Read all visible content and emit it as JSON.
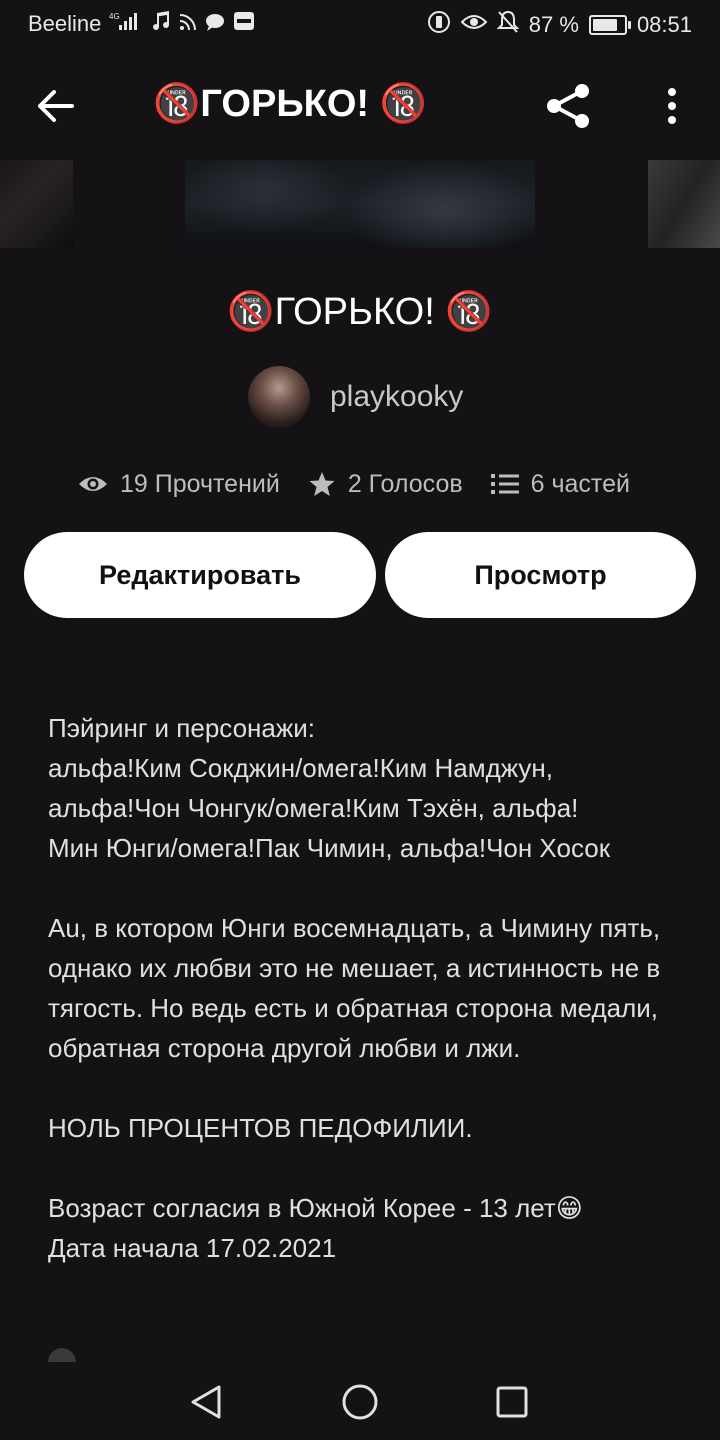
{
  "status_bar": {
    "carrier": "Beeline",
    "network": "4G",
    "battery_percent": "87 %",
    "battery_level": 0.87,
    "time": "08:51"
  },
  "app_bar": {
    "title": "🔞ГОРЬКО! 🔞"
  },
  "story": {
    "title": "🔞ГОРЬКО! 🔞",
    "author": "playkooky",
    "reads": "19 Прочтений",
    "votes": "2 Голосов",
    "parts": "6 частей"
  },
  "buttons": {
    "edit": "Редактировать",
    "view": "Просмотр"
  },
  "description": {
    "pairing_label": "Пэйринг и персонажи:",
    "pairing_1": "альфа!Ким Сокджин/омега!Ким Намджун,",
    "pairing_2": "альфа!Чон Чонгук/омега!Ким Тэхён, альфа!",
    "pairing_3": "Мин Юнги/омега!Пак Чимин, альфа!Чон Хосок",
    "summary": "Au, в котором Юнги восемнадцать, а Чимину пять, однако их любви это не мешает, а истинность не в тягость. Но ведь есть и обратная сторона медали, обратная сторона другой любви и лжи.",
    "notice": "НОЛЬ ПРОЦЕНТОВ ПЕДОФИЛИИ.",
    "age_note": "Возраст согласия в Южной Корее - 13 лет😁",
    "start_date": "Дата начала 17.02.2021"
  },
  "icons": {
    "back": "arrow-left-icon",
    "share": "share-icon",
    "more": "more-vertical-icon",
    "reads": "eye-icon",
    "votes": "star-icon",
    "parts": "list-icon"
  },
  "colors": {
    "background": "#141214",
    "button_bg": "#ffffff",
    "button_text": "#111111",
    "muted_text": "#bdbdbd"
  }
}
